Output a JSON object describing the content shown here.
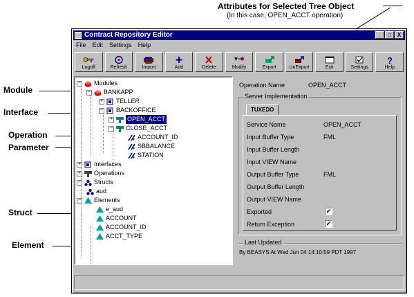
{
  "callouts": {
    "attributes_title": "Attributes for Selected Tree Object",
    "attributes_sub": "(In this case, OPEN_ACCT operation)",
    "module": "Module",
    "interface": "Interface",
    "operation": "Operation",
    "parameter": "Parameter",
    "struct": "Struct",
    "element": "Element"
  },
  "window": {
    "title": "Contract Repository Editor",
    "controls": {
      "minimize": "_",
      "maximize": "□",
      "close": "X"
    }
  },
  "menu": [
    "File",
    "Edit",
    "Settings",
    "Help"
  ],
  "toolbar": [
    {
      "label": "Logoff",
      "icon": "key-icon"
    },
    {
      "label": "Refresh",
      "icon": "refresh-icon"
    },
    {
      "label": "Import",
      "icon": "import-icon"
    },
    {
      "label": "Add",
      "icon": "add-icon"
    },
    {
      "label": "Delete",
      "icon": "delete-icon"
    },
    {
      "label": "Modify",
      "icon": "modify-icon"
    },
    {
      "label": "Export",
      "icon": "export-icon"
    },
    {
      "label": "UnExport",
      "icon": "unexport-icon"
    },
    {
      "label": "Exit",
      "icon": "exit-icon"
    },
    {
      "label": "Settings",
      "icon": "settings-icon"
    },
    {
      "label": "Help",
      "icon": "help-icon"
    }
  ],
  "tree": {
    "modules": "Modules",
    "bankapp": "BANKAPP",
    "teller": "TELLER",
    "backoffice": "BACKOFFICE",
    "open_acct": "OPEN_ACCT",
    "close_acct": "CLOSE_ACCT",
    "account_id": "ACCOUNT_ID",
    "sbbalance": "SBBALANCE",
    "station": "STATION",
    "interfaces": "Interfaces",
    "operations": "Operations",
    "structs": "Structs",
    "aud": "aud",
    "elements": "Elements",
    "el_aud": "e_aud",
    "account": "ACCOUNT",
    "account_id2": "ACCOUNT_ID",
    "acct_type": "ACCT_TYPE"
  },
  "details": {
    "operation_name_label": "Operation Name",
    "operation_name_value": "OPEN_ACCT",
    "server_impl_label": "Server Implementation",
    "tab": "TUXEDO",
    "service_name_label": "Service Name",
    "service_name_value": "OPEN_ACCT",
    "input_buffer_type_label": "Input Buffer Type",
    "input_buffer_type_value": "FML",
    "input_buffer_length_label": "Input Buffer Length",
    "input_view_name_label": "Input VIEW Name",
    "output_buffer_type_label": "Output Buffer Type",
    "output_buffer_type_value": "FML",
    "output_buffer_length_label": "Output Buffer Length",
    "output_view_name_label": "Output VIEW Name",
    "exported_label": "Exported",
    "exported_checked": "✔",
    "return_exception_label": "Return Exception",
    "return_exception_checked": "✔",
    "last_updated_label": "Last Updated",
    "last_updated_value": "By BEASYS At Wed Jun 04 14:10:59 PDT 1997"
  }
}
